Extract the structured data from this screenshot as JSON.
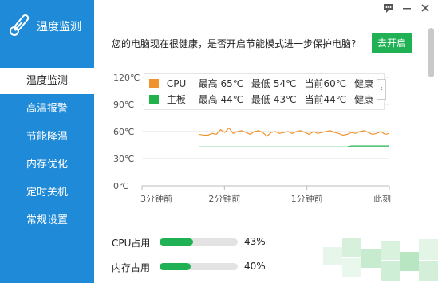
{
  "app": {
    "title": "温度监测",
    "accent": "#1f8ad8",
    "brand_icon": "thermometer-icon"
  },
  "topbar": {
    "feedback_icon": "chat-bubble-icon",
    "minimize_icon": "minimize-icon",
    "close_icon": "close-icon"
  },
  "sidebar": {
    "items": [
      {
        "label": "温度监测",
        "active": true
      },
      {
        "label": "高温报警",
        "active": false
      },
      {
        "label": "节能降温",
        "active": false
      },
      {
        "label": "内存优化",
        "active": false
      },
      {
        "label": "定时关机",
        "active": false
      },
      {
        "label": "常规设置",
        "active": false
      }
    ]
  },
  "banner": {
    "text": "您的电脑现在很健康，是否开启节能模式进一步保护电脑?",
    "button_label": "去开启",
    "button_color": "#1fb154"
  },
  "chart_data": {
    "type": "line",
    "y_ticks": [
      "120℃",
      "90℃",
      "60℃",
      "30℃",
      "0℃"
    ],
    "x_ticks": [
      "3分钟前",
      "2分钟前",
      "1分钟前",
      "此刻"
    ],
    "ylim": [
      0,
      120
    ],
    "grid": true,
    "series": [
      {
        "name": "CPU",
        "color": "#f0922e",
        "values": [
          57,
          56,
          56,
          58,
          57,
          62,
          59,
          64,
          58,
          60,
          61,
          59,
          57,
          60,
          61,
          59,
          55,
          59,
          60,
          58,
          59,
          60,
          58,
          60,
          61,
          59,
          57,
          60,
          58,
          59,
          60,
          61,
          59,
          58,
          56,
          57,
          59,
          58,
          60,
          61,
          59,
          57,
          58,
          60,
          57,
          58
        ]
      },
      {
        "name": "主板",
        "color": "#22b24c",
        "values": [
          43,
          43,
          43,
          43,
          43,
          43,
          43,
          43,
          43,
          43,
          43,
          43,
          43,
          43,
          43,
          43,
          43,
          43,
          43,
          43,
          43,
          43,
          43,
          43,
          43,
          43,
          43,
          43,
          43,
          43,
          43,
          43,
          43,
          43,
          43,
          43,
          44,
          44,
          44,
          44,
          44,
          44,
          44,
          44,
          44,
          44
        ]
      }
    ],
    "legend": [
      {
        "name": "CPU",
        "max": "最高 65℃",
        "min": "最低 54℃",
        "current": "当前60℃",
        "status": "健康",
        "color": "#f0922e"
      },
      {
        "name": "主板",
        "max": "最高 44℃",
        "min": "最低 43℃",
        "current": "当前44℃",
        "status": "健康",
        "color": "#22b24c"
      }
    ]
  },
  "usage": [
    {
      "label": "CPU占用",
      "percent": 43,
      "percent_text": "43%"
    },
    {
      "label": "内存占用",
      "percent": 40,
      "percent_text": "40%"
    }
  ]
}
